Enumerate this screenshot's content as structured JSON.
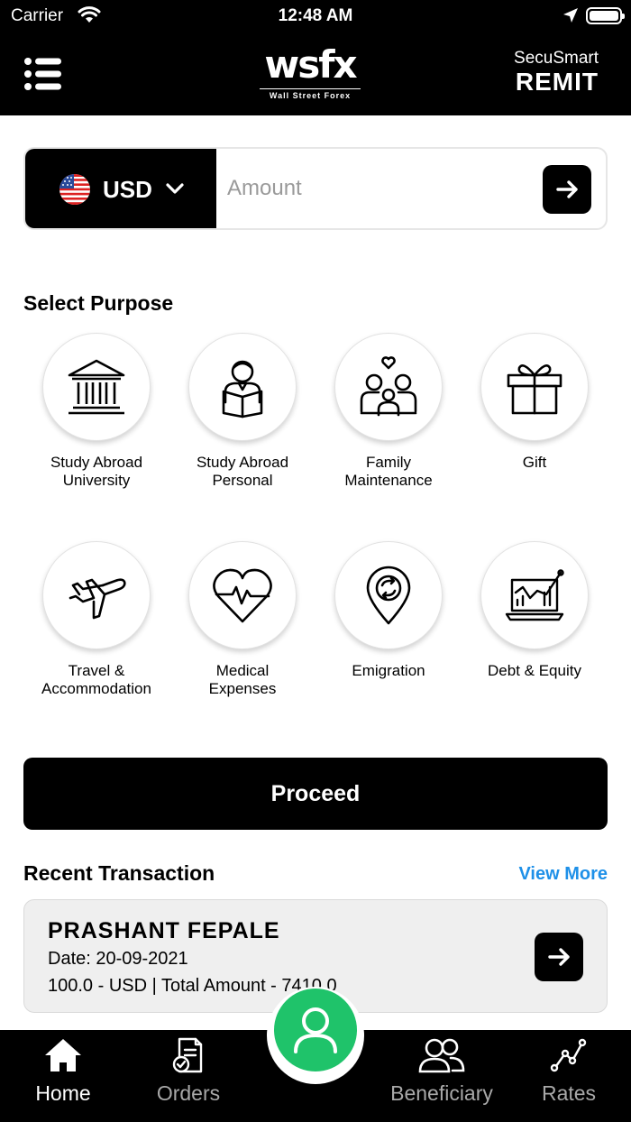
{
  "status_bar": {
    "carrier": "Carrier",
    "time": "12:48 AM"
  },
  "header": {
    "logo_text": "wsfx",
    "logo_subtitle": "Wall Street Forex",
    "brand_small": "SecuSmart",
    "brand_big": "REMIT"
  },
  "amount": {
    "currency_code": "USD",
    "placeholder": "Amount",
    "value": ""
  },
  "purpose_section": {
    "title": "Select Purpose",
    "items": [
      {
        "label": "Study Abroad\nUniversity",
        "icon": "university-icon"
      },
      {
        "label": "Study Abroad\nPersonal",
        "icon": "student-reading-icon"
      },
      {
        "label": "Family\nMaintenance",
        "icon": "family-icon"
      },
      {
        "label": "Gift",
        "icon": "gift-icon"
      },
      {
        "label": "Travel &\nAccommodation",
        "icon": "airplane-icon"
      },
      {
        "label": "Medical\nExpenses",
        "icon": "heart-pulse-icon"
      },
      {
        "label": "Emigration",
        "icon": "location-exchange-icon"
      },
      {
        "label": "Debt & Equity",
        "icon": "laptop-chart-icon"
      }
    ]
  },
  "proceed_label": "Proceed",
  "recent": {
    "title": "Recent Transaction",
    "view_more": "View More",
    "transaction": {
      "name": "PRASHANT FEPALE",
      "date": "Date: 20-09-2021",
      "summary": "100.0 - USD | Total Amount - 7410.0"
    }
  },
  "bottom_nav": {
    "items": [
      {
        "label": "Home",
        "icon": "home-icon",
        "active": true
      },
      {
        "label": "Orders",
        "icon": "orders-icon",
        "active": false
      },
      {
        "label": "Beneficiary",
        "icon": "beneficiary-icon",
        "active": false
      },
      {
        "label": "Rates",
        "icon": "rates-icon",
        "active": false
      }
    ],
    "center_icon": "profile-icon"
  },
  "colors": {
    "primary": "#000000",
    "link": "#1e90e8",
    "fab": "#1fc36a",
    "card_bg": "#efefef"
  }
}
